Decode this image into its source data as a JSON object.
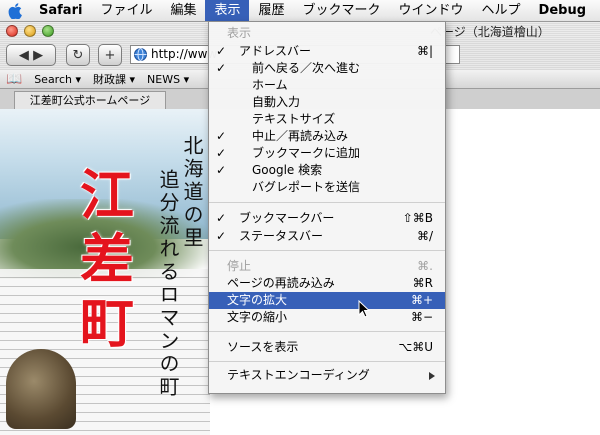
{
  "menubar": {
    "app": "Safari",
    "items": [
      "ファイル",
      "編集",
      "表示",
      "履歴",
      "ブックマーク",
      "ウインドウ",
      "ヘルプ",
      "Debug"
    ]
  },
  "window": {
    "title": "ページ（北海道檜山）",
    "address_value": "http://www",
    "bookmarks": [
      "Search ▾",
      "財政課 ▾",
      "NEWS ▾"
    ],
    "tab_label": "江差町公式ホームページ"
  },
  "page": {
    "big_kanji": "江差町",
    "col1": "北海道の里",
    "col2": "追分流れるロマンの町"
  },
  "menu": {
    "header": "表示",
    "items": [
      {
        "label": "アドレスバー",
        "shortcut": "⌘|",
        "checked": true
      },
      {
        "label": "前へ戻る／次へ進む",
        "checked": true
      },
      {
        "label": "ホーム"
      },
      {
        "label": "自動入力"
      },
      {
        "label": "テキストサイズ"
      },
      {
        "label": "中止／再読み込み",
        "checked": true
      },
      {
        "label": "ブックマークに追加",
        "checked": true
      },
      {
        "label": "Google 検索",
        "checked": true
      },
      {
        "label": "バグレポートを送信"
      },
      {
        "label": "ブックマークバー",
        "shortcut": "⇧⌘B",
        "checked": true
      },
      {
        "label": "ステータスバー",
        "shortcut": "⌘/",
        "checked": true
      },
      {
        "label": "停止",
        "shortcut": "⌘.",
        "disabled": true
      },
      {
        "label": "ページの再読み込み",
        "shortcut": "⌘R"
      },
      {
        "label": "文字の拡大",
        "shortcut": "⌘+",
        "highlighted": true
      },
      {
        "label": "文字の縮小",
        "shortcut": "⌘−"
      },
      {
        "label": "ソースを表示",
        "shortcut": "⌥⌘U"
      },
      {
        "label": "テキストエンコーディング"
      }
    ]
  },
  "colors": {
    "highlight": "#3760b8",
    "accent_red": "#e4141d"
  }
}
